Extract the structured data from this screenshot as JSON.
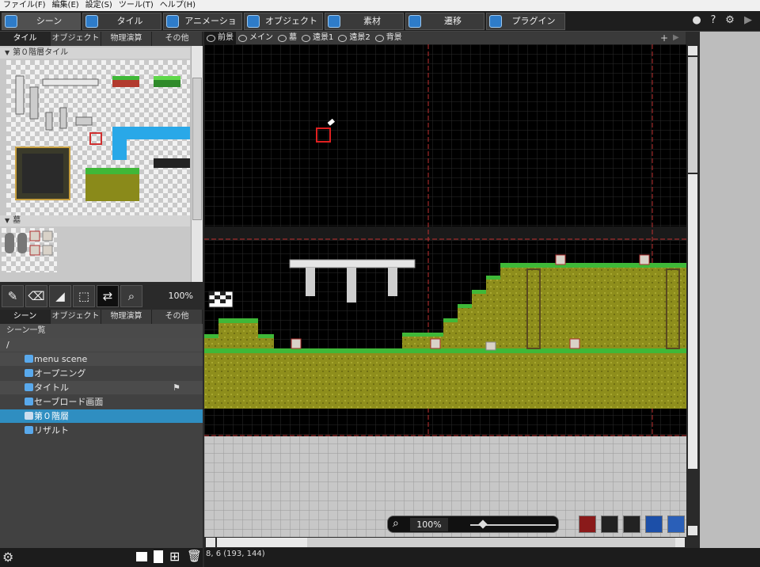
{
  "menu": [
    "ファイル(F)",
    "編集(E)",
    "設定(S)",
    "ツール(T)",
    "ヘルプ(H)"
  ],
  "toolbar": {
    "tabs": [
      {
        "label": "シーン",
        "icon": "scene-icon"
      },
      {
        "label": "タイル",
        "icon": "tile-icon"
      },
      {
        "label": "アニメーション",
        "icon": "animation-icon"
      },
      {
        "label": "オブジェクト",
        "icon": "object-icon"
      },
      {
        "label": "素材",
        "icon": "material-icon"
      },
      {
        "label": "遷移",
        "icon": "transition-icon"
      },
      {
        "label": "プラグイン",
        "icon": "plugin-icon"
      }
    ],
    "right_icons": [
      "circle-icon",
      "help-icon",
      "gear-icon",
      "play-icon"
    ]
  },
  "left_tabs": [
    "タイル",
    "オブジェクト",
    "物理演算",
    "その他"
  ],
  "tile_groups": [
    "第０階層タイル",
    "墓"
  ],
  "tools": {
    "zoom": "100%",
    "icons": [
      "pen-icon",
      "eraser-icon",
      "fill-icon",
      "select-icon",
      "layer-toggle-icon",
      "zoom-icon"
    ]
  },
  "scene_tabs": [
    "シーン",
    "オブジェクト",
    "物理演算",
    "その他"
  ],
  "scene_header": "シーン一覧",
  "scene_root": "/",
  "scenes": [
    "menu scene",
    "オープニング",
    "タイトル",
    "セーブロード画面",
    "第０階層",
    "リザルト"
  ],
  "selected_scene": "第０階層",
  "layers": [
    "前景",
    "メイン",
    "墓",
    "遠景1",
    "遠景2",
    "背景"
  ],
  "active_layer": "前景",
  "canvas": {
    "zoom": "100%"
  },
  "status": "8, 6 (193, 144)",
  "colors": {
    "accent": "#2f8ec1",
    "grass": "#3fb838",
    "dirt": "#8a8a1a",
    "canvas_bg": "#000000"
  }
}
